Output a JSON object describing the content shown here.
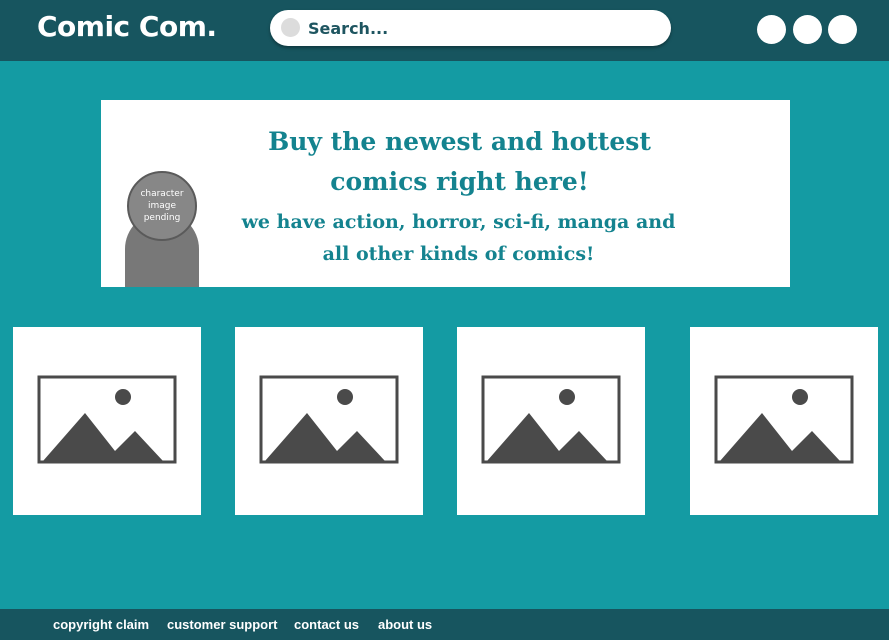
{
  "header": {
    "logo": "Comic Com.",
    "search_placeholder": "Search...",
    "search_icon": "search-icon",
    "buttons": [
      "header-button-1",
      "header-button-2",
      "header-button-3"
    ]
  },
  "hero": {
    "title": "Buy the newest and hottest comics right here!",
    "subtitle": "we have action, horror, sci-fi, manga and all other kinds of comics!",
    "character_placeholder": "character image pending"
  },
  "products": [
    {
      "icon": "image-placeholder-icon"
    },
    {
      "icon": "image-placeholder-icon"
    },
    {
      "icon": "image-placeholder-icon"
    },
    {
      "icon": "image-placeholder-icon"
    }
  ],
  "footer": {
    "links": [
      "copyright claim",
      "customer support",
      "contact us",
      "about us"
    ]
  },
  "colors": {
    "header_bg": "#17555f",
    "page_bg": "#149ba3",
    "accent_text": "#14838f",
    "placeholder_gray": "#4a4a4a"
  }
}
